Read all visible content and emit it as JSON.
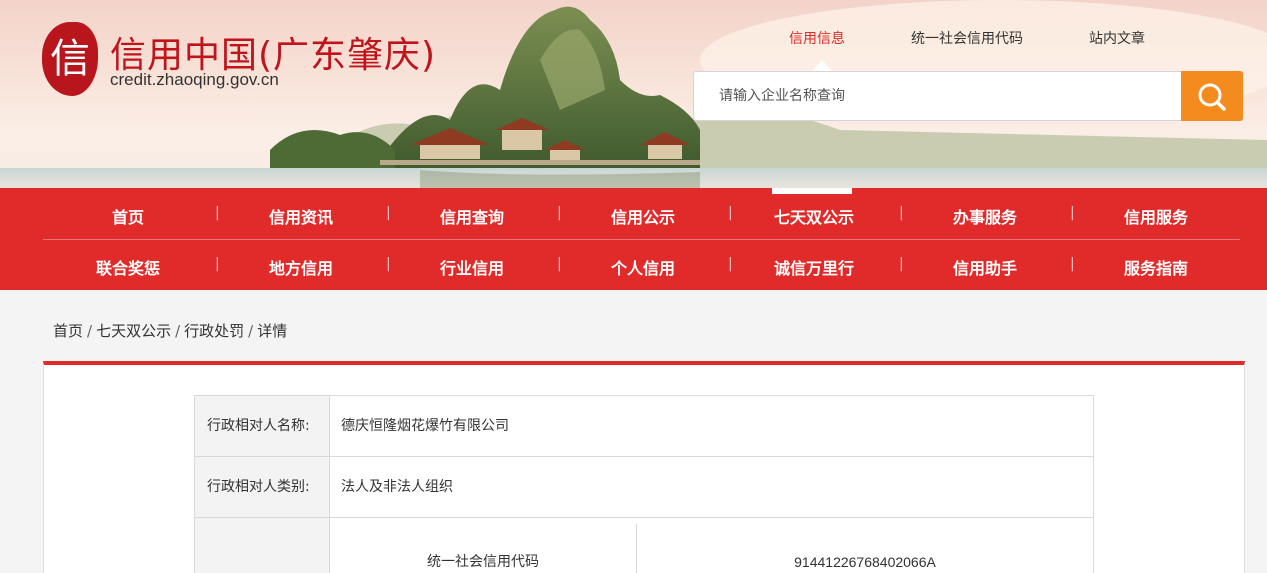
{
  "logo": {
    "badge_char": "信",
    "title": "信用中国(广东肇庆)",
    "domain": "credit.zhaoqing.gov.cn"
  },
  "top_links": [
    {
      "label": "信用信息",
      "active": true
    },
    {
      "label": "统一社会信用代码",
      "active": false
    },
    {
      "label": "站内文章",
      "active": false
    }
  ],
  "search": {
    "placeholder": "请输入企业名称查询"
  },
  "nav": {
    "row1": [
      "首页",
      "信用资讯",
      "信用查询",
      "信用公示",
      "七天双公示",
      "办事服务",
      "信用服务"
    ],
    "row2": [
      "联合奖惩",
      "地方信用",
      "行业信用",
      "个人信用",
      "诚信万里行",
      "信用助手",
      "服务指南"
    ],
    "active": "七天双公示",
    "separator": "|"
  },
  "breadcrumb": {
    "items": [
      "首页",
      "七天双公示",
      "行政处罚",
      "详情"
    ],
    "separator": "/"
  },
  "detail": {
    "rows": [
      {
        "label": "行政相对人名称:",
        "value": "德庆恒隆烟花爆竹有限公司"
      },
      {
        "label": "行政相对人类别:",
        "value": "法人及非法人组织"
      }
    ],
    "sub_key": "统一社会信用代码",
    "sub_value": "91441226768402066A"
  },
  "colors": {
    "brand_red": "#e12a2a",
    "search_orange": "#f38b1f",
    "active_link": "#d92b26"
  }
}
